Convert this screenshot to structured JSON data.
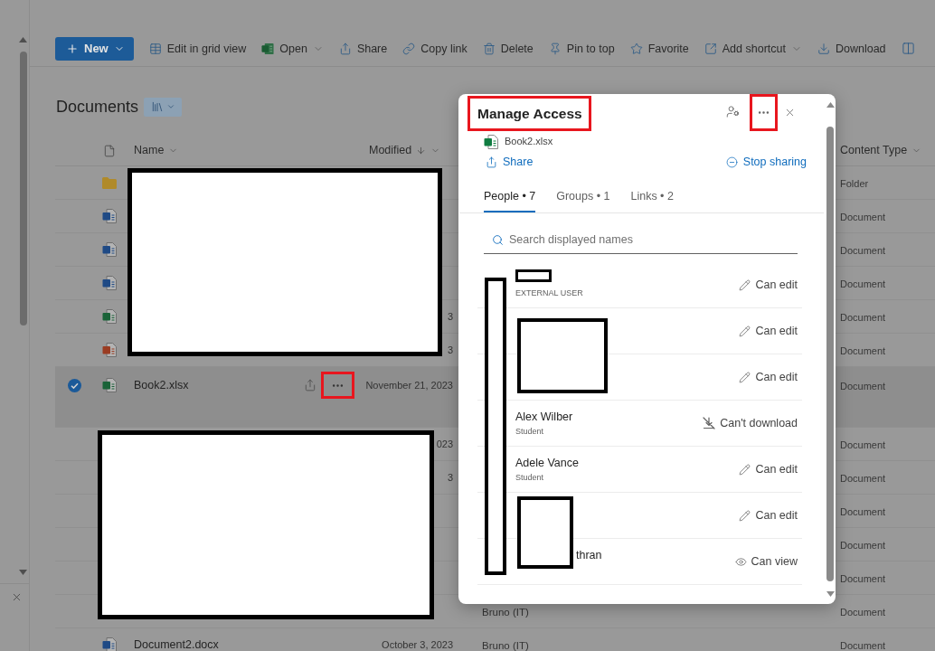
{
  "toolbar": [
    {
      "kind": "primary",
      "label": "New",
      "has_menu": true
    },
    {
      "kind": "command",
      "label": "Edit in grid view",
      "has_menu": false
    },
    {
      "kind": "command",
      "label": "Open",
      "has_menu": true
    },
    {
      "kind": "command",
      "label": "Share",
      "has_menu": false
    },
    {
      "kind": "command",
      "label": "Copy link",
      "has_menu": false
    },
    {
      "kind": "command",
      "label": "Delete",
      "has_menu": false
    },
    {
      "kind": "command",
      "label": "Pin to top",
      "has_menu": false
    },
    {
      "kind": "command",
      "label": "Favorite",
      "has_menu": false
    },
    {
      "kind": "command",
      "label": "Add shortcut",
      "has_menu": true
    },
    {
      "kind": "command",
      "label": "Download",
      "has_menu": false
    }
  ],
  "library": {
    "title": "Documents"
  },
  "table": {
    "columns": [
      {
        "label": "Name",
        "sorted": false
      },
      {
        "label": "Modified",
        "sorted": true
      },
      {
        "label": "Content Type",
        "sorted": false
      }
    ],
    "rows": [
      {
        "kind": "folder",
        "selected": false,
        "content_type": "Folder"
      },
      {
        "kind": "word",
        "selected": false,
        "content_type": "Document"
      },
      {
        "kind": "word",
        "selected": false,
        "content_type": "Document"
      },
      {
        "kind": "word",
        "selected": false,
        "content_type": "Document"
      },
      {
        "kind": "excel",
        "selected": false,
        "modified": "3",
        "content_type": "Document"
      },
      {
        "kind": "powerpoint",
        "selected": false,
        "modified": "3",
        "content_type": "Document"
      },
      {
        "kind": "excel",
        "selected": true,
        "name": "Book2.xlsx",
        "modified": "November 21, 2023",
        "content_type": "Document"
      },
      {
        "selected": false,
        "modified": "023",
        "content_type": "Document"
      },
      {
        "selected": false,
        "modified": "3",
        "content_type": "Document"
      },
      {
        "selected": false,
        "content_type": "Document"
      },
      {
        "selected": false,
        "content_type": "Document"
      },
      {
        "selected": false,
        "content_type": "Document"
      },
      {
        "selected": false,
        "modified_by": "Bruno (IT)",
        "content_type": "Document"
      },
      {
        "kind": "word",
        "selected": false,
        "name": "Document2.docx",
        "modified": "October 3, 2023",
        "modified_by": "Bruno (IT)",
        "content_type": "Document"
      }
    ]
  },
  "manage_access": {
    "title": "Manage Access",
    "file_name": "Book2.xlsx",
    "share_label": "Share",
    "stop_sharing_label": "Stop sharing",
    "tabs": [
      {
        "label": "People • 7",
        "selected": true
      },
      {
        "label": "Groups • 1",
        "selected": false
      },
      {
        "label": "Links • 2",
        "selected": false
      }
    ],
    "search": {
      "placeholder": "Search displayed names"
    },
    "people": [
      {
        "role": "EXTERNAL USER",
        "permission": "Can edit",
        "kind": "edit"
      },
      {
        "permission": "Can edit",
        "kind": "edit"
      },
      {
        "permission": "Can edit",
        "kind": "edit"
      },
      {
        "name": "Alex Wilber",
        "role": "Student",
        "permission": "Can't download",
        "kind": "no_download"
      },
      {
        "name": "Adele Vance",
        "role": "Student",
        "permission": "Can edit",
        "kind": "edit"
      },
      {
        "permission": "Can edit",
        "kind": "edit"
      },
      {
        "name": "thran",
        "permission": "Can view",
        "kind": "view"
      }
    ]
  }
}
